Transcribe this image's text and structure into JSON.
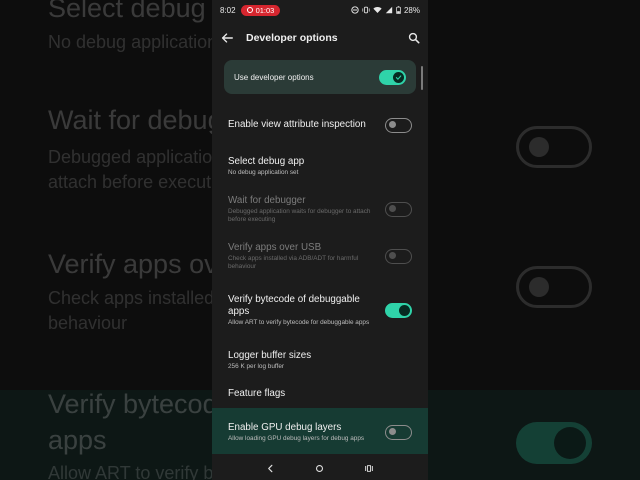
{
  "background": {
    "select_debug_title": "Select debug app",
    "select_debug_sub": "No debug application set",
    "wait_title": "Wait for debugger",
    "wait_sub_line1": "Debugged application waits for debugger to",
    "wait_sub_line2": "attach before executing",
    "verify_title": "Verify apps over USB",
    "verify_sub_line1": "Check apps installed via ADB/ADT for harmful",
    "verify_sub_line2": "behaviour",
    "bytecode_title_line1": "Verify bytecode of debuggable",
    "bytecode_title_line2": "apps",
    "bytecode_sub": "Allow ART to verify bytecode for debuggable"
  },
  "status_bar": {
    "time": "8:02",
    "recording_timer": "01:03",
    "battery": "28%"
  },
  "toolbar": {
    "title": "Developer options"
  },
  "master_switch": {
    "label": "Use developer options",
    "on": true
  },
  "settings": [
    {
      "title": "Enable view attribute inspection",
      "subtitle": "",
      "toggle": "off",
      "enabled": true
    },
    {
      "title": "Select debug app",
      "subtitle": "No debug application set",
      "toggle": "none",
      "enabled": true
    },
    {
      "title": "Wait for debugger",
      "subtitle": "Debugged application waits for debugger to attach before executing",
      "toggle": "off",
      "enabled": false
    },
    {
      "title": "Verify apps over USB",
      "subtitle": "Check apps installed via ADB/ADT for harmful behaviour",
      "toggle": "off",
      "enabled": false
    },
    {
      "title": "Verify bytecode of debuggable apps",
      "subtitle": "Allow ART to verify bytecode for debuggable apps",
      "toggle": "on",
      "enabled": true
    },
    {
      "title": "Logger buffer sizes",
      "subtitle": "256 K per log buffer",
      "toggle": "none",
      "enabled": true
    },
    {
      "title": "Feature flags",
      "subtitle": "",
      "toggle": "none",
      "enabled": true
    },
    {
      "title": "Enable GPU debug layers",
      "subtitle": "Allow loading GPU debug layers for debug apps",
      "toggle": "off",
      "enabled": true
    }
  ],
  "colors": {
    "accent": "#2fd3a9",
    "surface": "#1c1c1c",
    "master_bg": "#2b3b37",
    "highlight_row": "#163b33",
    "recording": "#d6262f"
  }
}
